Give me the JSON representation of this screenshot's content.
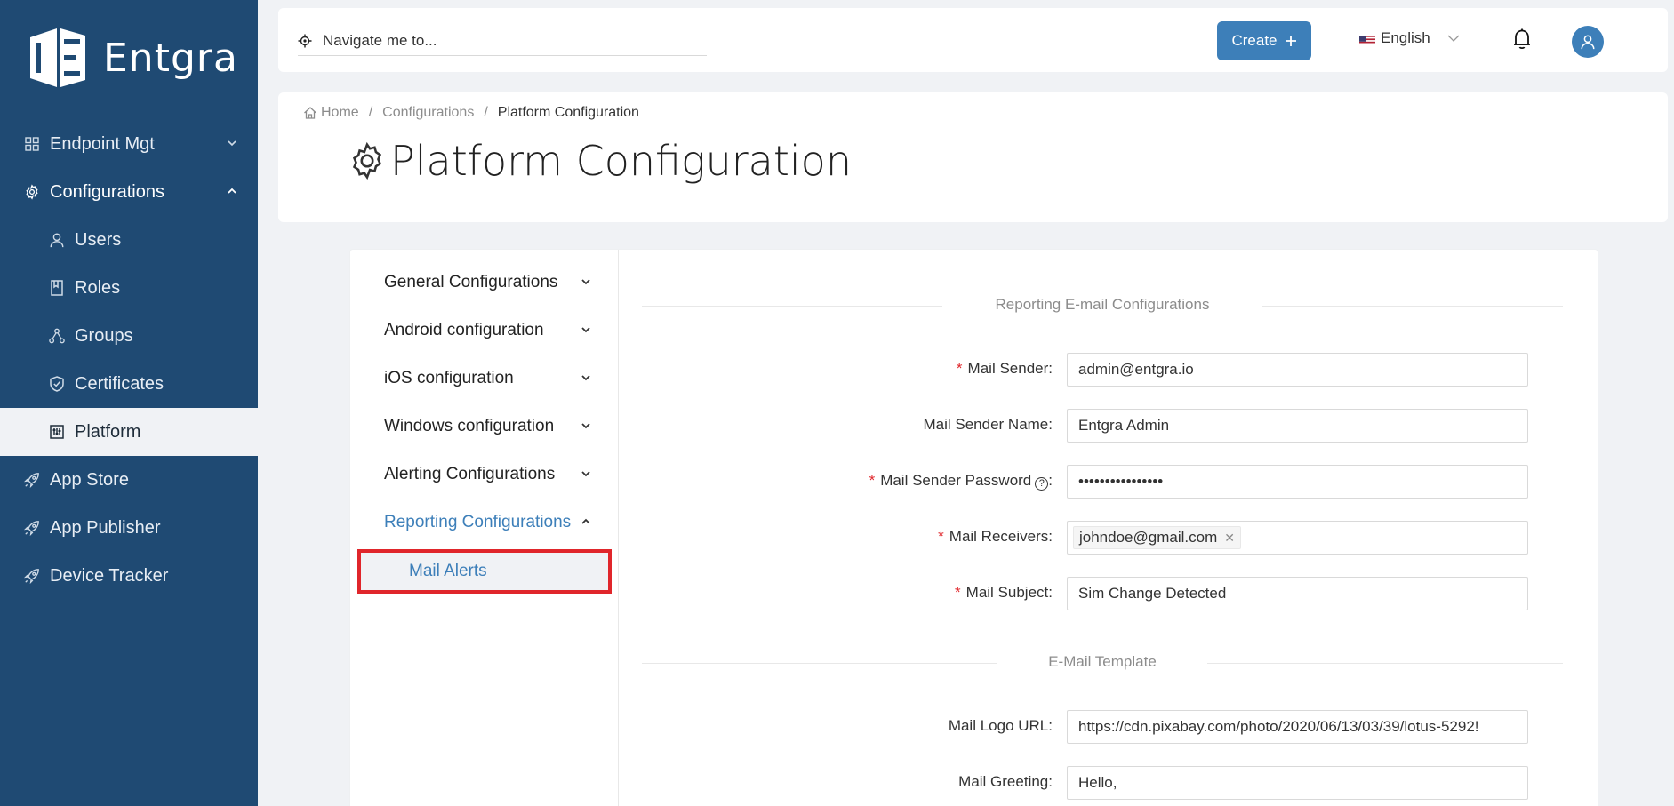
{
  "brand": {
    "name": "Entgra"
  },
  "sidebar": {
    "items": [
      {
        "label": "Endpoint Mgt",
        "icon": "grid-icon",
        "chevron": "down"
      },
      {
        "label": "Configurations",
        "icon": "gear-icon",
        "chevron": "up"
      },
      {
        "label": "Users",
        "icon": "user-icon"
      },
      {
        "label": "Roles",
        "icon": "book-icon"
      },
      {
        "label": "Groups",
        "icon": "cluster-icon"
      },
      {
        "label": "Certificates",
        "icon": "shield-icon"
      },
      {
        "label": "Platform",
        "icon": "sliders-icon"
      },
      {
        "label": "App Store",
        "icon": "rocket-icon"
      },
      {
        "label": "App Publisher",
        "icon": "rocket-icon"
      },
      {
        "label": "Device Tracker",
        "icon": "rocket-icon"
      }
    ]
  },
  "topbar": {
    "search_placeholder": "Navigate me to...",
    "create_label": "Create",
    "language": "English"
  },
  "breadcrumb": {
    "home": "Home",
    "configurations": "Configurations",
    "current": "Platform Configuration"
  },
  "page_title": "Platform Configuration",
  "config_menu": {
    "items": [
      {
        "label": "General Configurations",
        "expanded": false
      },
      {
        "label": "Android configuration",
        "expanded": false
      },
      {
        "label": "iOS configuration",
        "expanded": false
      },
      {
        "label": "Windows configuration",
        "expanded": false
      },
      {
        "label": "Alerting Configurations",
        "expanded": false
      },
      {
        "label": "Reporting Configurations",
        "expanded": true
      }
    ],
    "sub_item": "Mail Alerts"
  },
  "form": {
    "section1_title": "Reporting E-mail Configurations",
    "section2_title": "E-Mail Template",
    "fields": {
      "mail_sender": {
        "label": "Mail Sender",
        "value": "admin@entgra.io",
        "required": true
      },
      "mail_sender_name": {
        "label": "Mail Sender Name",
        "value": "Entgra Admin",
        "required": false
      },
      "mail_sender_password": {
        "label": "Mail Sender Password",
        "value": "••••••••••••••••",
        "required": true
      },
      "mail_receivers": {
        "label": "Mail Receivers",
        "tag": "johndoe@gmail.com",
        "required": true
      },
      "mail_subject": {
        "label": "Mail Subject",
        "value": "Sim Change Detected",
        "required": true
      },
      "mail_logo_url": {
        "label": "Mail Logo URL",
        "value": "https://cdn.pixabay.com/photo/2020/06/13/03/39/lotus-5292!",
        "required": false
      },
      "mail_greeting": {
        "label": "Mail Greeting",
        "value": "Hello,",
        "required": false
      }
    }
  },
  "colors": {
    "sidebar": "#1f4a73",
    "accent": "#3d7fb9",
    "highlight_border": "#e0262b"
  }
}
